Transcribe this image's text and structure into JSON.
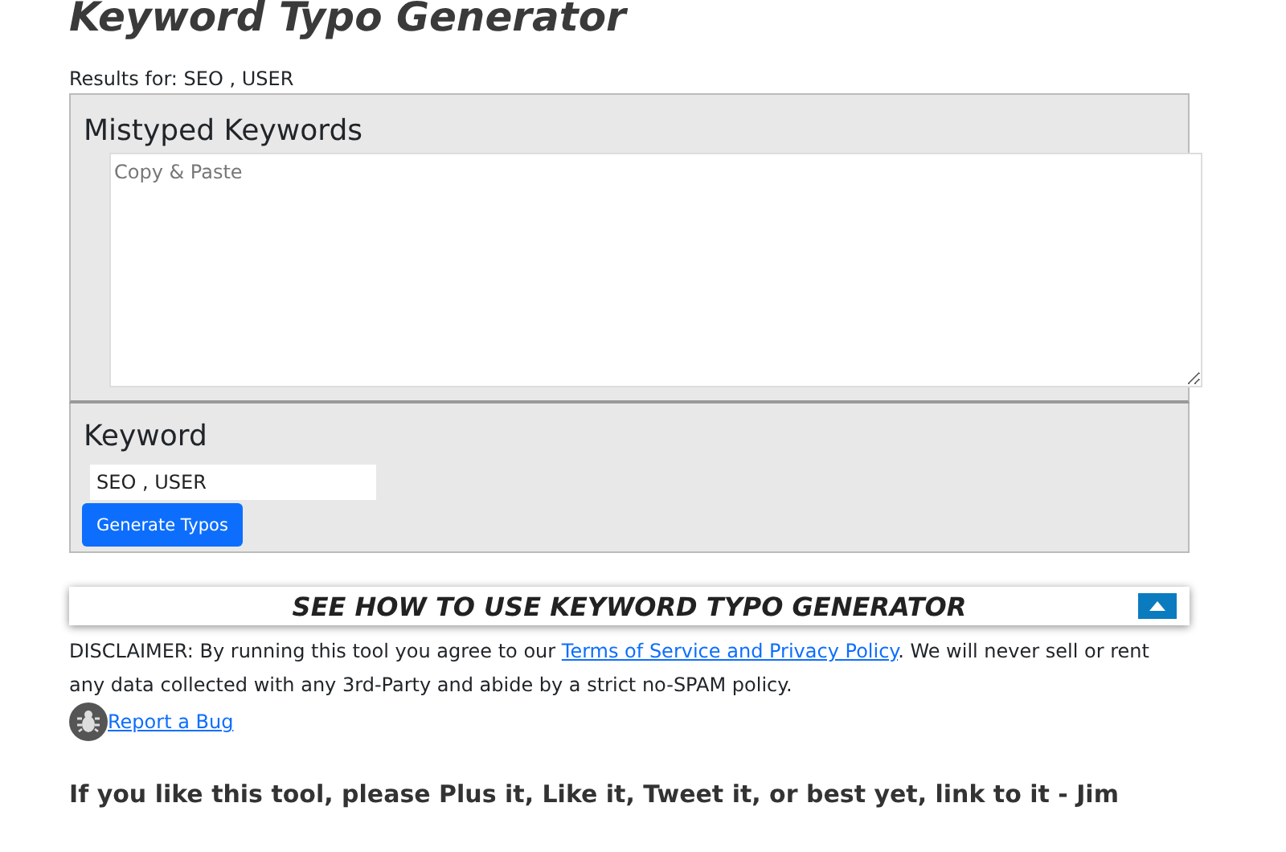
{
  "title": "Keyword Typo Generator",
  "results_label": "Results for: SEO , USER",
  "mistyped": {
    "label": "Mistyped Keywords",
    "placeholder": "Copy & Paste"
  },
  "keyword": {
    "label": "Keyword",
    "value": "SEO , USER"
  },
  "generate_button": "Generate Typos",
  "howto": {
    "title": "SEE HOW TO USE KEYWORD TYPO GENERATOR",
    "expanded": false
  },
  "disclaimer": {
    "before": "DISCLAIMER: By running this tool you agree to our ",
    "link": "Terms of Service and Privacy Policy",
    "after": ". We will never sell or rent any data collected with any 3rd-Party and abide by a strict no-SPAM policy."
  },
  "report_link": "Report a Bug",
  "footer": "If you like this tool, please Plus it, Like it, Tweet it, or best yet, link to it - Jim"
}
